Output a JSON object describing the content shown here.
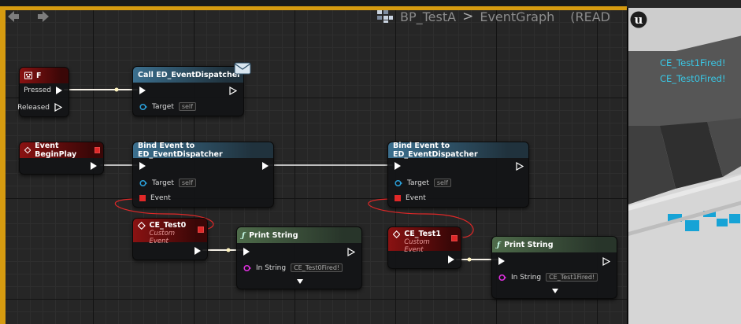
{
  "breadcrumb": {
    "blueprint": "BP_TestA",
    "separator": ">",
    "graph": "EventGraph",
    "mode": "(READ"
  },
  "nodes": {
    "key_f": {
      "title": "F",
      "pressed": "Pressed",
      "released": "Released"
    },
    "call_dispatcher": {
      "title": "Call ED_EventDispatcher",
      "target": "Target",
      "self": "self"
    },
    "begin_play": {
      "title": "Event BeginPlay"
    },
    "bind_event_1": {
      "title": "Bind Event to ED_EventDispatcher",
      "target": "Target",
      "self": "self",
      "event": "Event"
    },
    "bind_event_2": {
      "title": "Bind Event to ED_EventDispatcher",
      "target": "Target",
      "self": "self",
      "event": "Event"
    },
    "ce_test0": {
      "title": "CE_Test0",
      "subtitle": "Custom Event"
    },
    "ce_test1": {
      "title": "CE_Test1",
      "subtitle": "Custom Event"
    },
    "print_string_1": {
      "title": "Print String",
      "in_string": "In String",
      "value": "CE_Test0Fired!"
    },
    "print_string_2": {
      "title": "Print String",
      "in_string": "In String",
      "value": "CE_Test1Fired!"
    }
  },
  "viewport": {
    "log": [
      "CE_Test1Fired!",
      "CE_Test0Fired!"
    ]
  },
  "icons": {
    "back": "arrow-left-icon",
    "forward": "arrow-right-icon",
    "blueprint": "blueprint-grid-icon",
    "engine": "unreal-logo-icon",
    "mail": "envelope-icon",
    "function": "function-icon"
  },
  "colors": {
    "frame": "#d69b10",
    "event_header": "#8a1212",
    "function_header": "#3b6f8e",
    "print_header": "#4e6b4a",
    "log_text": "#39c8e6",
    "event_wire": "#e02828"
  }
}
